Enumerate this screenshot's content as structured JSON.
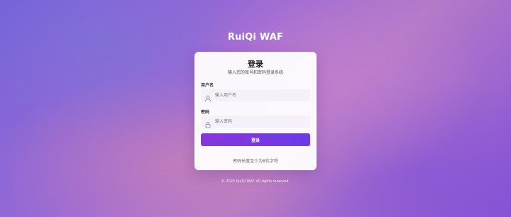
{
  "brand": {
    "title": "RuiQi WAF"
  },
  "login": {
    "title": "登录",
    "subtitle": "输入您的账号和密码登录系统",
    "username": {
      "label": "用户名",
      "placeholder": "输入用户名",
      "icon": "user-icon"
    },
    "password": {
      "label": "密码",
      "placeholder": "输入密码",
      "icon": "lock-icon"
    },
    "submit_label": "登录",
    "hint": "密码长度至少为8位字符"
  },
  "footer": {
    "copyright": "© 2025 RuiQi WAF. All rights reserved."
  },
  "colors": {
    "accent_start": "#8a35dd",
    "accent_end": "#6a3be6"
  }
}
